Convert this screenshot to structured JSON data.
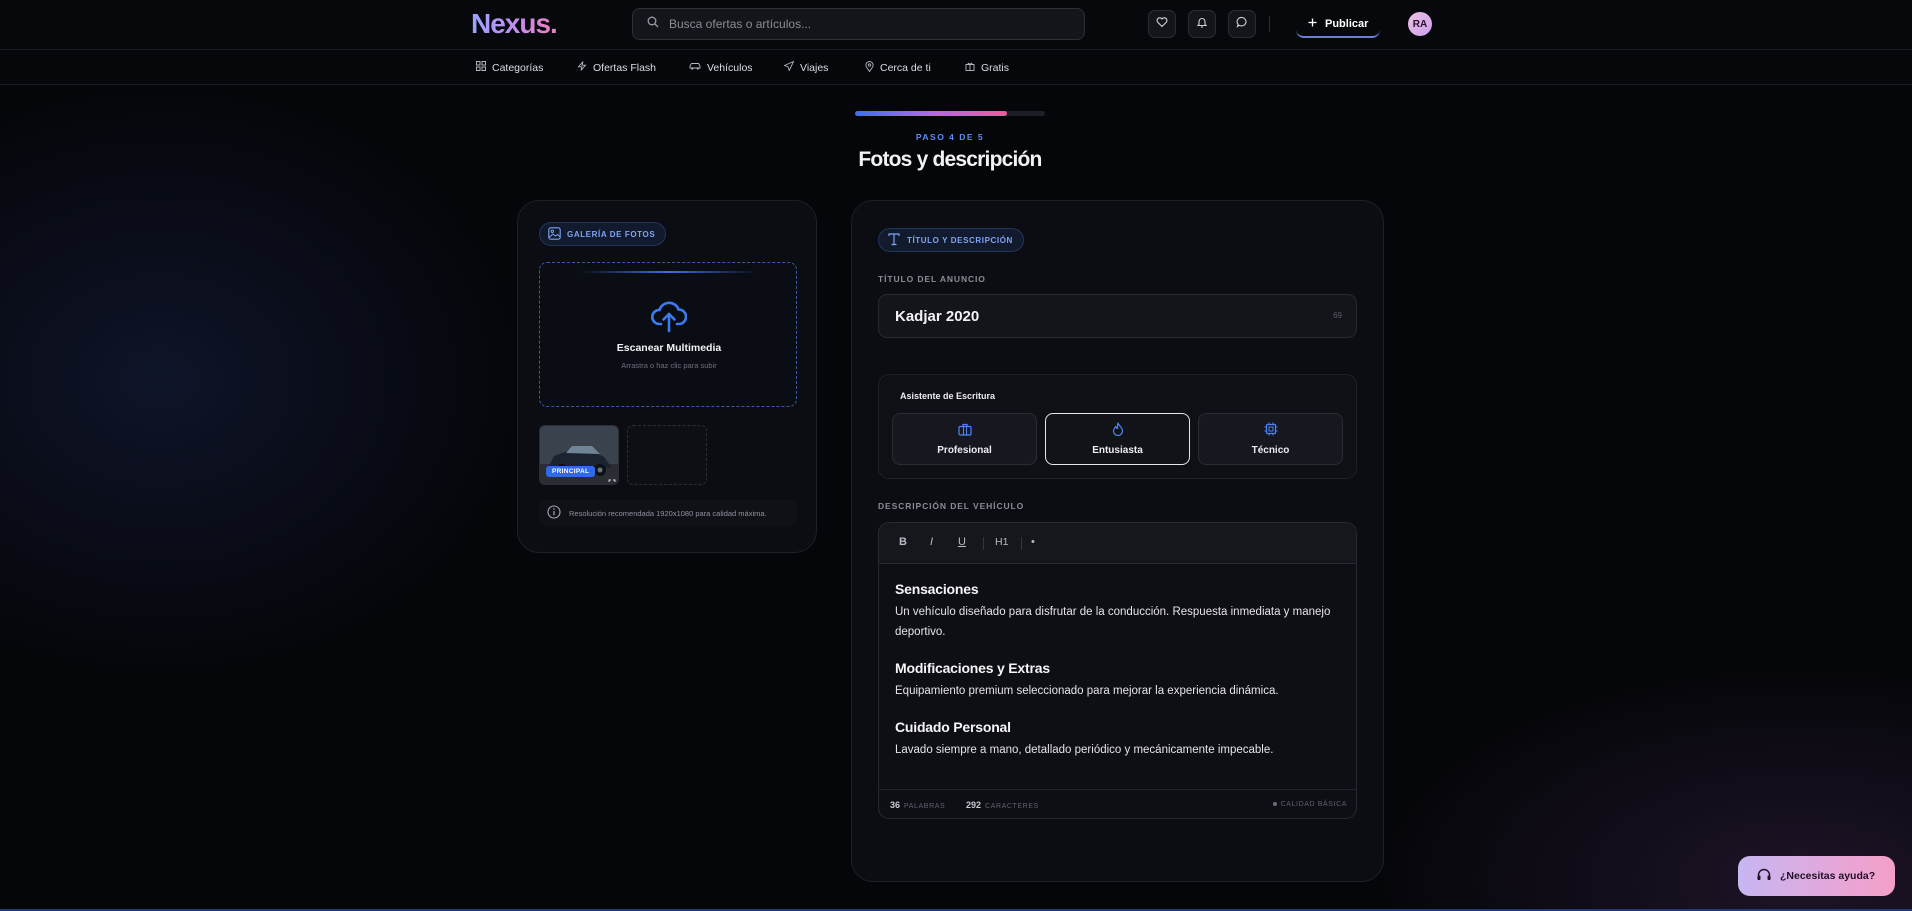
{
  "header": {
    "logo": "Nexus.",
    "search_placeholder": "Busca ofertas o artículos...",
    "publish_label": "Publicar",
    "avatar_initials": "RA"
  },
  "nav": {
    "items": [
      {
        "label": "Categorías",
        "icon": "grid-icon"
      },
      {
        "label": "Ofertas Flash",
        "icon": "lightning-icon"
      },
      {
        "label": "Vehículos",
        "icon": "car-icon"
      },
      {
        "label": "Viajes",
        "icon": "plane-icon"
      },
      {
        "label": "Cerca de ti",
        "icon": "map-pin-icon"
      },
      {
        "label": "Gratis",
        "icon": "gift-icon"
      }
    ]
  },
  "wizard": {
    "step_label": "PASO 4 DE 5",
    "progress_fraction": 0.8,
    "title": "Fotos y descripción"
  },
  "gallery": {
    "chip": "GALERÍA DE FOTOS",
    "dropzone_title": "Escanear Multimedia",
    "dropzone_subtitle": "Arrastra o haz clic para subir",
    "thumb_badge": "PRINCIPAL",
    "info_text": "Resolución recomendada 1920x1080 para calidad máxima."
  },
  "details": {
    "chip": "TÍTULO Y DESCRIPCIÓN",
    "title_label": "TÍTULO DEL ANUNCIO",
    "title_value": "Kadjar 2020",
    "title_remaining": "69",
    "assistant_title": "Asistente de Escritura",
    "tones": [
      {
        "label": "Profesional",
        "icon": "briefcase-icon",
        "active": false
      },
      {
        "label": "Entusiasta",
        "icon": "flame-icon",
        "active": true
      },
      {
        "label": "Técnico",
        "icon": "cpu-icon",
        "active": false
      }
    ],
    "description_label": "DESCRIPCIÓN DEL VEHÍCULO",
    "toolbar": {
      "bold": "B",
      "italic": "I",
      "underline": "U",
      "heading": "H1",
      "bullet": "•"
    },
    "sections": [
      {
        "heading": "Sensaciones",
        "text": "Un vehículo diseñado para disfrutar de la conducción. Respuesta inmediata y manejo deportivo."
      },
      {
        "heading": "Modificaciones y Extras",
        "text": "Equipamiento premium seleccionado para mejorar la experiencia dinámica."
      },
      {
        "heading": "Cuidado Personal",
        "text": "Lavado siempre a mano, detallado periódico y mecánicamente impecable."
      }
    ],
    "word_count": "36",
    "word_label": "PALABRAS",
    "char_count": "292",
    "char_label": "CARACTERES",
    "quality_label": "CALIDAD BÁSICA"
  },
  "help": {
    "label": "¿Necesitas ayuda?"
  },
  "colors": {
    "accent": "#3b6ff0",
    "pink": "#ef5a9a",
    "purple": "#b06ae8",
    "background": "#05060a"
  }
}
